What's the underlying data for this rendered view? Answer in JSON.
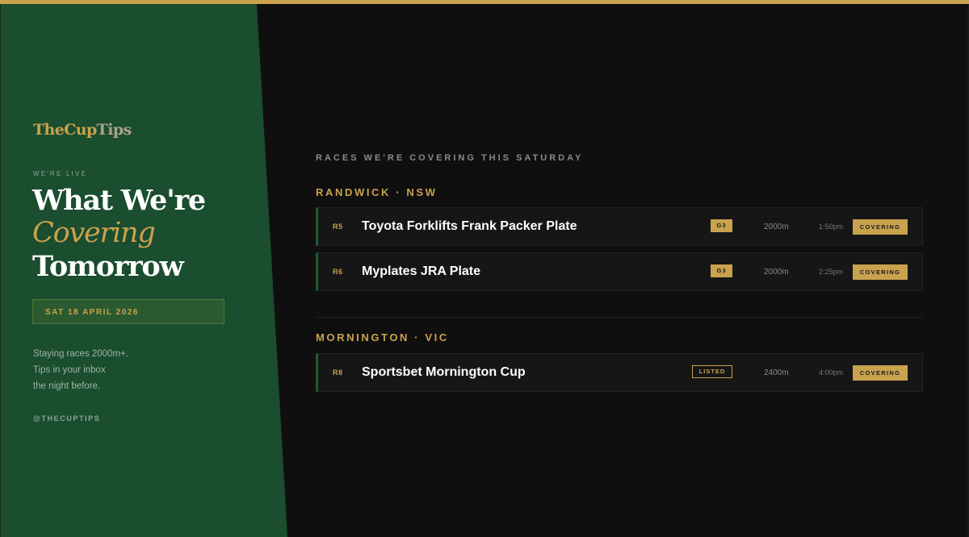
{
  "brand": {
    "name_part1": "TheCup",
    "name_part2": "Tips",
    "gold": "#c9a24e",
    "green": "#1b4d2f"
  },
  "sidebar": {
    "eyebrow": "WE'RE LIVE",
    "hero_line1": "What We're",
    "hero_line2": "Covering",
    "hero_line3": "Tomorrow",
    "date": "SAT 18 APRIL 2026",
    "blurb": [
      "Staying races 2000m+.",
      "Tips in your inbox",
      "the night before."
    ],
    "handle": "@THECUPTIPS"
  },
  "main": {
    "kicker": "RACES WE'RE COVERING THIS SATURDAY",
    "venues": [
      {
        "name": "RANDWICK · NSW",
        "races": [
          {
            "num": "R5",
            "title": "Toyota Forklifts Frank Packer Plate",
            "grade": "G3",
            "distance": "2000m",
            "time": "1:50pm",
            "status": "COVERING"
          },
          {
            "num": "R6",
            "title": "Myplates JRA Plate",
            "grade": "G3",
            "distance": "2000m",
            "time": "2:25pm",
            "status": "COVERING"
          }
        ]
      },
      {
        "name": "MORNINGTON · VIC",
        "races": [
          {
            "num": "R8",
            "title": "Sportsbet Mornington Cup",
            "grade": "LISTED",
            "distance": "2400m",
            "time": "4:00pm",
            "status": "COVERING"
          }
        ]
      }
    ]
  }
}
